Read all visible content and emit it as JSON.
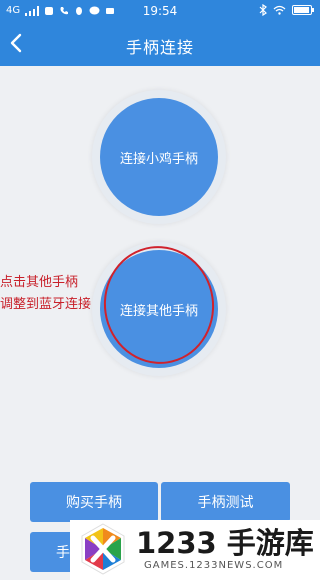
{
  "status_bar": {
    "network": "4G",
    "time": "19:54"
  },
  "header": {
    "title": "手柄连接"
  },
  "buttons": {
    "connect_xiaoji": "连接小鸡手柄",
    "connect_other": "连接其他手柄"
  },
  "annotation": {
    "line1": "点击其他手柄",
    "line2": "调整到蓝牙连接"
  },
  "bottom_bar": {
    "buy": "购买手柄",
    "test": "手柄测试",
    "partial": "手"
  },
  "watermark": {
    "brand": "1233 手游库",
    "domain": "GAMES.1233NEWS.COM"
  },
  "colors": {
    "primary": "#2f86dc",
    "button": "#4a90e2",
    "annotation": "#d0222c"
  }
}
